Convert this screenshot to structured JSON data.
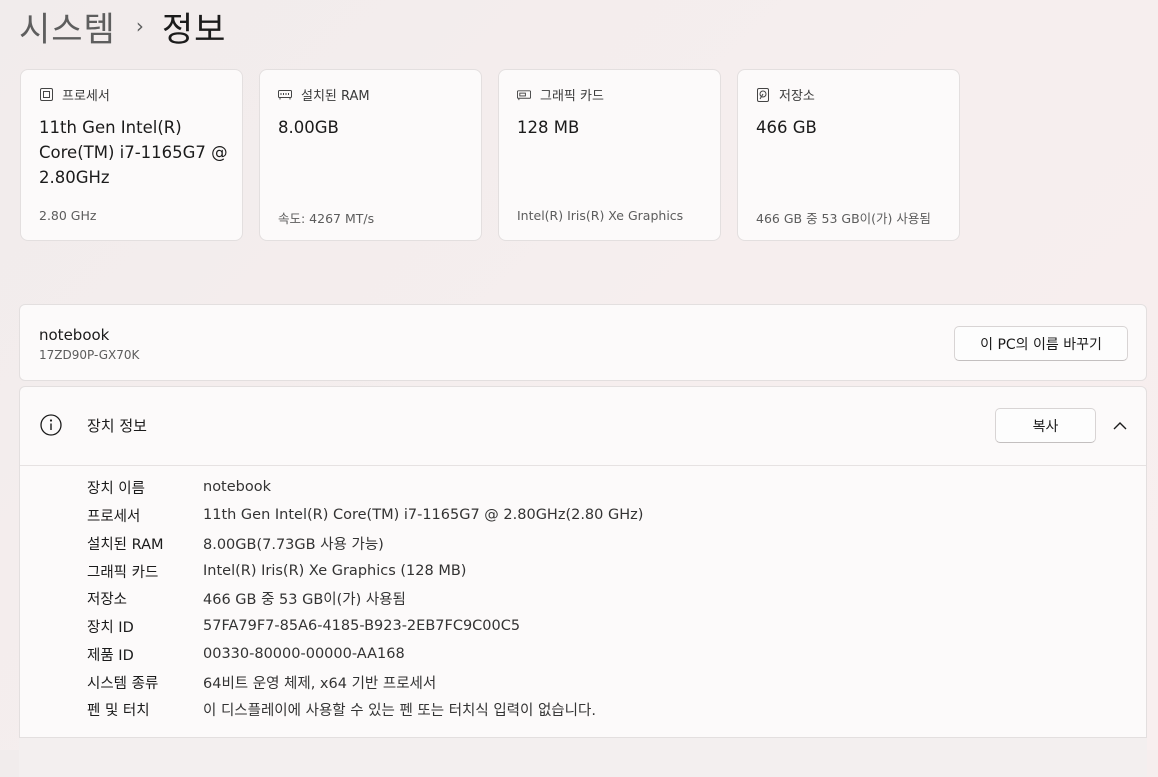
{
  "breadcrumb": {
    "parent": "시스템",
    "separator": "›",
    "current": "정보"
  },
  "cards": [
    {
      "icon": "processor-icon",
      "label": "프로세서",
      "value": "11th Gen Intel(R) Core(TM) i7-1165G7 @ 2.80GHz",
      "sub": "2.80 GHz"
    },
    {
      "icon": "ram-icon",
      "label": "설치된 RAM",
      "value": "8.00GB",
      "sub": "속도: 4267 MT/s"
    },
    {
      "icon": "graphics-card-icon",
      "label": "그래픽 카드",
      "value": "128 MB",
      "sub": "Intel(R) Iris(R) Xe Graphics"
    },
    {
      "icon": "storage-icon",
      "label": "저장소",
      "value": "466 GB",
      "sub": "466 GB 중 53 GB이(가) 사용됨"
    }
  ],
  "pc": {
    "name": "notebook",
    "model": "17ZD90P-GX70K",
    "rename_label": "이 PC의 이름 바꾸기"
  },
  "device_info": {
    "title": "장치 정보",
    "copy_label": "복사",
    "rows": [
      {
        "key": "장치 이름",
        "value": "notebook"
      },
      {
        "key": "프로세서",
        "value": "11th Gen Intel(R) Core(TM) i7-1165G7 @ 2.80GHz(2.80 GHz)"
      },
      {
        "key": "설치된 RAM",
        "value": "8.00GB(7.73GB 사용 가능)"
      },
      {
        "key": "그래픽 카드",
        "value": "Intel(R) Iris(R) Xe Graphics (128 MB)"
      },
      {
        "key": "저장소",
        "value": "466 GB 중 53 GB이(가) 사용됨"
      },
      {
        "key": "장치 ID",
        "value": "57FA79F7-85A6-4185-B923-2EB7FC9C00C5"
      },
      {
        "key": "제품 ID",
        "value": "00330-80000-00000-AA168"
      },
      {
        "key": "시스템 종류",
        "value": "64비트 운영 체제, x64 기반 프로세서"
      },
      {
        "key": "펜 및 터치",
        "value": "이 디스플레이에 사용할 수 있는 펜 또는 터치식 입력이 없습니다."
      }
    ]
  }
}
